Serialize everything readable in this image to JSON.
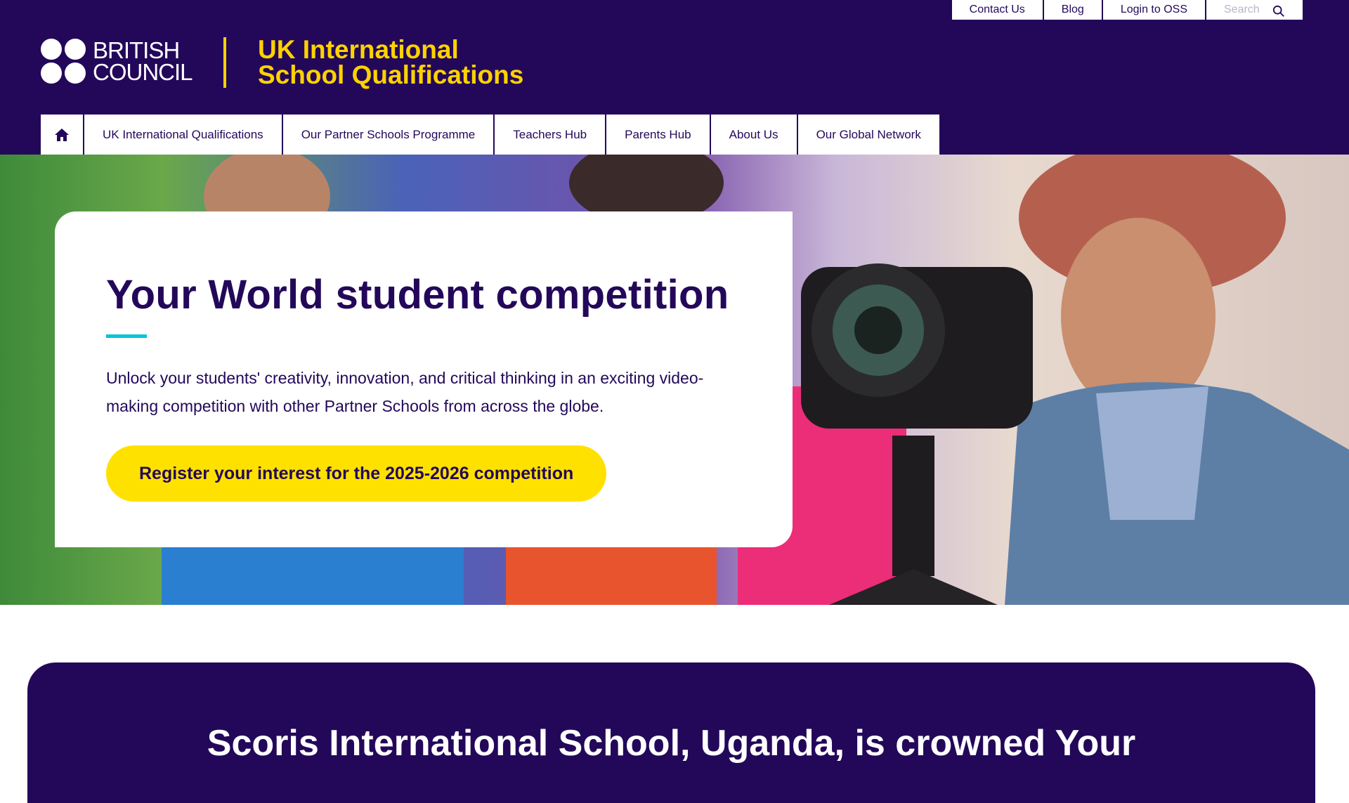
{
  "utility_nav": {
    "items": [
      "Contact Us",
      "Blog",
      "Login to OSS"
    ],
    "search_placeholder": "Search"
  },
  "logo": {
    "line1": "BRITISH",
    "line2": "COUNCIL"
  },
  "site_title": {
    "line1": "UK International",
    "line2": "School Qualifications"
  },
  "main_nav": {
    "home_icon": "home-icon",
    "items": [
      "UK International Qualifications",
      "Our Partner Schools Programme",
      "Teachers Hub",
      "Parents Hub",
      "About Us",
      "Our Global Network"
    ]
  },
  "hero": {
    "title": "Your World student competition",
    "description": "Unlock your students' creativity, innovation, and critical thinking in an exciting video-making competition with other Partner Schools from across the globe.",
    "cta_label": "Register your interest for the 2025-2026 competition"
  },
  "announcement": {
    "title": "Scoris International School, Uganda, is crowned Your"
  },
  "colors": {
    "brand_purple": "#23085a",
    "accent_yellow": "#ffd200",
    "cta_yellow": "#ffe100",
    "accent_cyan": "#00c5d8"
  }
}
